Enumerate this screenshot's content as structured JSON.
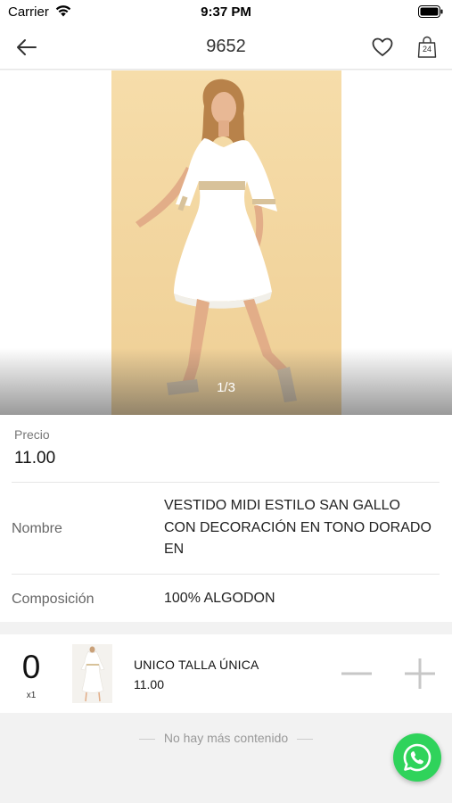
{
  "status_bar": {
    "carrier": "Carrier",
    "time": "9:37 PM"
  },
  "nav": {
    "title": "9652",
    "cart_count": "24",
    "icons": [
      "back-arrow-icon",
      "heart-icon",
      "shopping-bag-icon"
    ]
  },
  "gallery": {
    "counter": "1/3",
    "current_image": 1,
    "total_images": 3
  },
  "details": {
    "price_label": "Precio",
    "price_value": "11.00",
    "name_label": "Nombre",
    "name_value": "VESTIDO MIDI ESTILO SAN GALLO CON DECORACIÓN EN TONO DORADO EN",
    "composition_label": "Composición",
    "composition_value": "100% ALGODON"
  },
  "variant": {
    "quantity": "0",
    "multiplier": "x1",
    "name": "UNICO  TALLA ÚNICA",
    "price": "11.00"
  },
  "footer": {
    "end_text": "No hay más contenido"
  },
  "colors": {
    "whatsapp": "#2fd35b",
    "photo_background": "#f3d9a3",
    "dress": "#ffffff"
  }
}
